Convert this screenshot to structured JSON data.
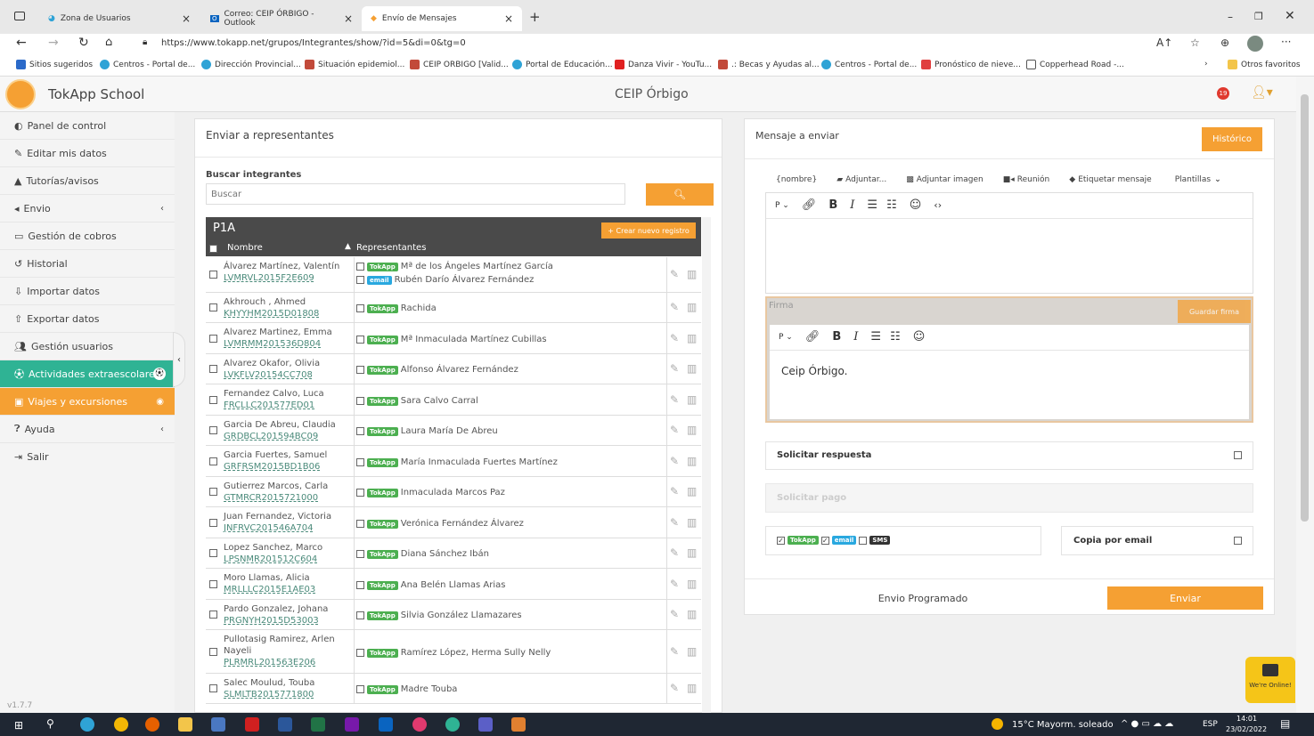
{
  "browser": {
    "tabs": [
      {
        "label": "Zona de Usuarios"
      },
      {
        "label": "Correo: CEIP ÓRBIGO - Outlook"
      },
      {
        "label": "Envío de Mensajes"
      }
    ],
    "url": "https://www.tokapp.net/grupos/Integrantes/show/?id=5&di=0&tg=0",
    "bookmarks": [
      "Sitios sugeridos",
      "Centros - Portal de...",
      "Dirección Provincial...",
      "Situación epidemiol...",
      "CEIP ORBIGO [Valid...",
      "Portal de Educación...",
      "Danza Vivir - YouTu...",
      ".: Becas y Ayudas al...",
      "Centros - Portal de...",
      "Pronóstico de nieve...",
      "Copperhead Road -..."
    ],
    "other_favorites": "Otros favoritos"
  },
  "app": {
    "name": "TokApp School",
    "school": "CEIP Órbigo",
    "version": "v1.7.7",
    "notif_count": "19"
  },
  "sidebar": {
    "items": [
      {
        "label": "Panel de control",
        "icon": "dashboard-icon"
      },
      {
        "label": "Editar mis datos",
        "icon": "edit-icon"
      },
      {
        "label": "Tutorías/avisos",
        "icon": "warning-icon"
      },
      {
        "label": "Envio",
        "icon": "send-icon"
      },
      {
        "label": "Gestión de cobros",
        "icon": "money-icon"
      },
      {
        "label": "Historial",
        "icon": "history-icon"
      },
      {
        "label": "Importar datos",
        "icon": "import-icon"
      },
      {
        "label": "Exportar datos",
        "icon": "export-icon"
      },
      {
        "label": "Gestión usuarios",
        "icon": "users-icon"
      },
      {
        "label": "Actividades extraescolares",
        "icon": "soccer-icon"
      },
      {
        "label": "Viajes y excursiones",
        "icon": "bus-icon"
      },
      {
        "label": "Ayuda",
        "icon": "help-icon"
      },
      {
        "label": "Salir",
        "icon": "logout-icon"
      }
    ]
  },
  "left": {
    "title": "Enviar a representantes",
    "search_label": "Buscar integrantes",
    "search_placeholder": "Buscar",
    "group": "P1A",
    "new_record": "+ Crear nuevo registro",
    "col_name": "Nombre",
    "col_reps": "Representantes",
    "rows": [
      {
        "name": "Álvarez Martínez, Valentín",
        "code": "LVMRVL2015F2E609",
        "reps": [
          {
            "badge": "TokApp",
            "name": "Mª de los Ángeles Martínez García"
          },
          {
            "badge": "email",
            "name": "Rubén Darío Álvarez Fernández"
          }
        ]
      },
      {
        "name": "Akhrouch , Ahmed",
        "code": "KHYYHM2015D01808",
        "reps": [
          {
            "badge": "TokApp",
            "name": "Rachida"
          }
        ]
      },
      {
        "name": "Alvarez Martinez, Emma",
        "code": "LVMRMM201536D804",
        "reps": [
          {
            "badge": "TokApp",
            "name": "Mª Inmaculada Martínez Cubillas"
          }
        ]
      },
      {
        "name": "Alvarez Okafor, Olivia",
        "code": "LVKFLV20154CC708",
        "reps": [
          {
            "badge": "TokApp",
            "name": "Alfonso Álvarez Fernández"
          }
        ]
      },
      {
        "name": "Fernandez Calvo, Luca",
        "code": "FRCLLC201577ED01",
        "reps": [
          {
            "badge": "TokApp",
            "name": "Sara Calvo Carral"
          }
        ]
      },
      {
        "name": "Garcia De Abreu, Claudia",
        "code": "GRDBCL201594BC09",
        "reps": [
          {
            "badge": "TokApp",
            "name": "Laura María De Abreu"
          }
        ]
      },
      {
        "name": "Garcia Fuertes, Samuel",
        "code": "GRFRSM2015BD1B06",
        "reps": [
          {
            "badge": "TokApp",
            "name": "María Inmaculada Fuertes Martínez"
          }
        ]
      },
      {
        "name": "Gutierrez Marcos, Carla",
        "code": "GTMRCR2015721000",
        "reps": [
          {
            "badge": "TokApp",
            "name": "Inmaculada Marcos Paz"
          }
        ]
      },
      {
        "name": "Juan Fernandez, Victoria",
        "code": "JNFRVC201546A704",
        "reps": [
          {
            "badge": "TokApp",
            "name": "Verónica Fernández Álvarez"
          }
        ]
      },
      {
        "name": "Lopez Sanchez, Marco",
        "code": "LPSNMR201512C604",
        "reps": [
          {
            "badge": "TokApp",
            "name": "Diana Sánchez Ibán"
          }
        ]
      },
      {
        "name": "Moro Llamas, Alicia",
        "code": "MRLLLC2015E1AE03",
        "reps": [
          {
            "badge": "TokApp",
            "name": "Ana Belén Llamas Arias"
          }
        ]
      },
      {
        "name": "Pardo Gonzalez, Johana",
        "code": "PRGNYH2015D53003",
        "reps": [
          {
            "badge": "TokApp",
            "name": "Silvia González Llamazares"
          }
        ]
      },
      {
        "name": "Pullotasig Ramirez, Arlen Nayeli",
        "code": "PLRMRL201563E206",
        "reps": [
          {
            "badge": "TokApp",
            "name": "Ramírez López, Herma Sully Nelly"
          }
        ]
      },
      {
        "name": "Salec Moulud, Touba",
        "code": "SLMLTB2015771800",
        "reps": [
          {
            "badge": "TokApp",
            "name": "Madre Touba"
          }
        ]
      }
    ]
  },
  "right": {
    "title": "Mensaje a enviar",
    "history_btn": "Histórico",
    "tools": [
      "{nombre}",
      "Adjuntar...",
      "Adjuntar imagen",
      "Reunión",
      "Etiquetar mensaje",
      "Plantillas"
    ],
    "firma_label": "Firma",
    "save_sig": "Guardar firma",
    "signature": "Ceip Órbigo.",
    "request_reply": "Solicitar respuesta",
    "request_payment": "Solicitar pago",
    "badges": [
      "TokApp",
      "email",
      "SMS"
    ],
    "copy_email": "Copia por email",
    "scheduled": "Envio Programado",
    "send": "Enviar"
  },
  "taskbar": {
    "weather": "15°C  Mayorm. soleado",
    "lang": "ESP",
    "time": "14:01",
    "date": "23/02/2022"
  },
  "chat": {
    "label": "We're Online!"
  }
}
